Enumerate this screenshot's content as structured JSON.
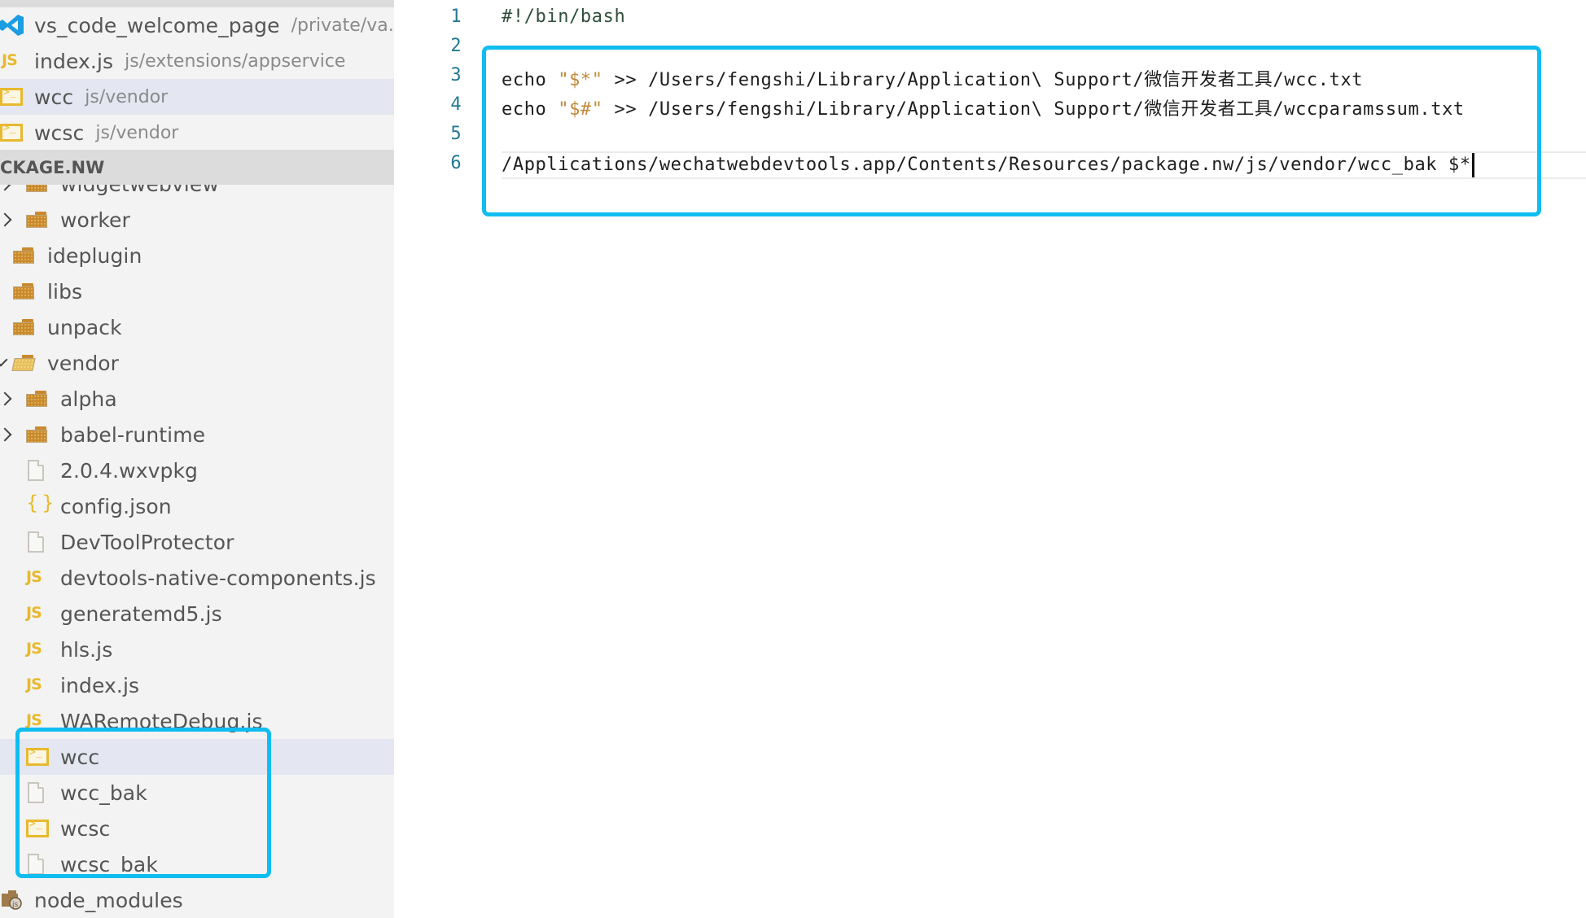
{
  "open_editors": [
    {
      "name": "vs_code_welcome_page",
      "description": "/private/va...",
      "icon": "vscode-icon",
      "selected": false
    },
    {
      "name": "index.js",
      "description": "js/extensions/appservice",
      "icon": "js-icon",
      "selected": false
    },
    {
      "name": "wcc",
      "description": "js/vendor",
      "icon": "terminal-icon",
      "selected": true
    },
    {
      "name": "wcsc",
      "description": "js/vendor",
      "icon": "terminal-icon",
      "selected": false
    }
  ],
  "explorer": {
    "section_title": "CKAGE.NW",
    "tree": [
      {
        "name": "widgetwebview",
        "icon": "folder-icon",
        "chevron": "right",
        "level": 2,
        "partial": true
      },
      {
        "name": "worker",
        "icon": "folder-icon",
        "chevron": "right",
        "level": 2
      },
      {
        "name": "ideplugin",
        "icon": "folder-icon",
        "chevron": "none",
        "level": 1
      },
      {
        "name": "libs",
        "icon": "folder-icon",
        "chevron": "none",
        "level": 1
      },
      {
        "name": "unpack",
        "icon": "folder-icon",
        "chevron": "none",
        "level": 1
      },
      {
        "name": "vendor",
        "icon": "folder-open-icon",
        "chevron": "down",
        "level": 1
      },
      {
        "name": "alpha",
        "icon": "folder-icon",
        "chevron": "right",
        "level": 2
      },
      {
        "name": "babel-runtime",
        "icon": "folder-icon",
        "chevron": "right",
        "level": 2
      },
      {
        "name": "2.0.4.wxvpkg",
        "icon": "file-icon",
        "chevron": "none",
        "level": 2
      },
      {
        "name": "config.json",
        "icon": "json-icon",
        "chevron": "none",
        "level": 2
      },
      {
        "name": "DevToolProtector",
        "icon": "file-icon",
        "chevron": "none",
        "level": 2
      },
      {
        "name": "devtools-native-components.js",
        "icon": "js-icon",
        "chevron": "none",
        "level": 2
      },
      {
        "name": "generatemd5.js",
        "icon": "js-icon",
        "chevron": "none",
        "level": 2
      },
      {
        "name": "hls.js",
        "icon": "js-icon",
        "chevron": "none",
        "level": 2
      },
      {
        "name": "index.js",
        "icon": "js-icon",
        "chevron": "none",
        "level": 2
      },
      {
        "name": "WARemoteDebug.js",
        "icon": "js-icon",
        "chevron": "none",
        "level": 2
      },
      {
        "name": "wcc",
        "icon": "terminal-icon",
        "chevron": "none",
        "level": 2,
        "selected": true
      },
      {
        "name": "wcc_bak",
        "icon": "file-icon",
        "chevron": "none",
        "level": 2
      },
      {
        "name": "wcsc",
        "icon": "terminal-icon",
        "chevron": "none",
        "level": 2
      },
      {
        "name": "wcsc_bak",
        "icon": "file-icon",
        "chevron": "none",
        "level": 2
      },
      {
        "name": "node_modules",
        "icon": "node-modules-icon",
        "chevron": "none",
        "level": 0
      }
    ]
  },
  "editor": {
    "lines": [
      {
        "number": "1",
        "segments": [
          {
            "text": "#!/bin/bash",
            "type": "comment"
          }
        ]
      },
      {
        "number": "2",
        "segments": []
      },
      {
        "number": "3",
        "segments": [
          {
            "text": "echo ",
            "type": "plain"
          },
          {
            "text": "\"$*\"",
            "type": "string"
          },
          {
            "text": " >> /Users/fengshi/Library/Application\\ Support/微信开发者工具/wcc.txt",
            "type": "plain"
          }
        ]
      },
      {
        "number": "4",
        "segments": [
          {
            "text": "echo ",
            "type": "plain"
          },
          {
            "text": "\"$#\"",
            "type": "string"
          },
          {
            "text": " >> /Users/fengshi/Library/Application\\ Support/微信开发者工具/wccparamssum.txt",
            "type": "plain"
          }
        ]
      },
      {
        "number": "5",
        "segments": []
      },
      {
        "number": "6",
        "segments": [
          {
            "text": "/Applications/wechatwebdevtools.app/Contents/Resources/package.nw/js/vendor/wcc_bak $*",
            "type": "plain"
          }
        ],
        "current": true
      }
    ]
  },
  "colors": {
    "highlight_box": "#0fbdf0",
    "selection": "#e4e6f1",
    "line_number": "#237893",
    "string": "#c18a38",
    "icon_yellow": "#e8b92e",
    "folder": "#c98a2e"
  }
}
